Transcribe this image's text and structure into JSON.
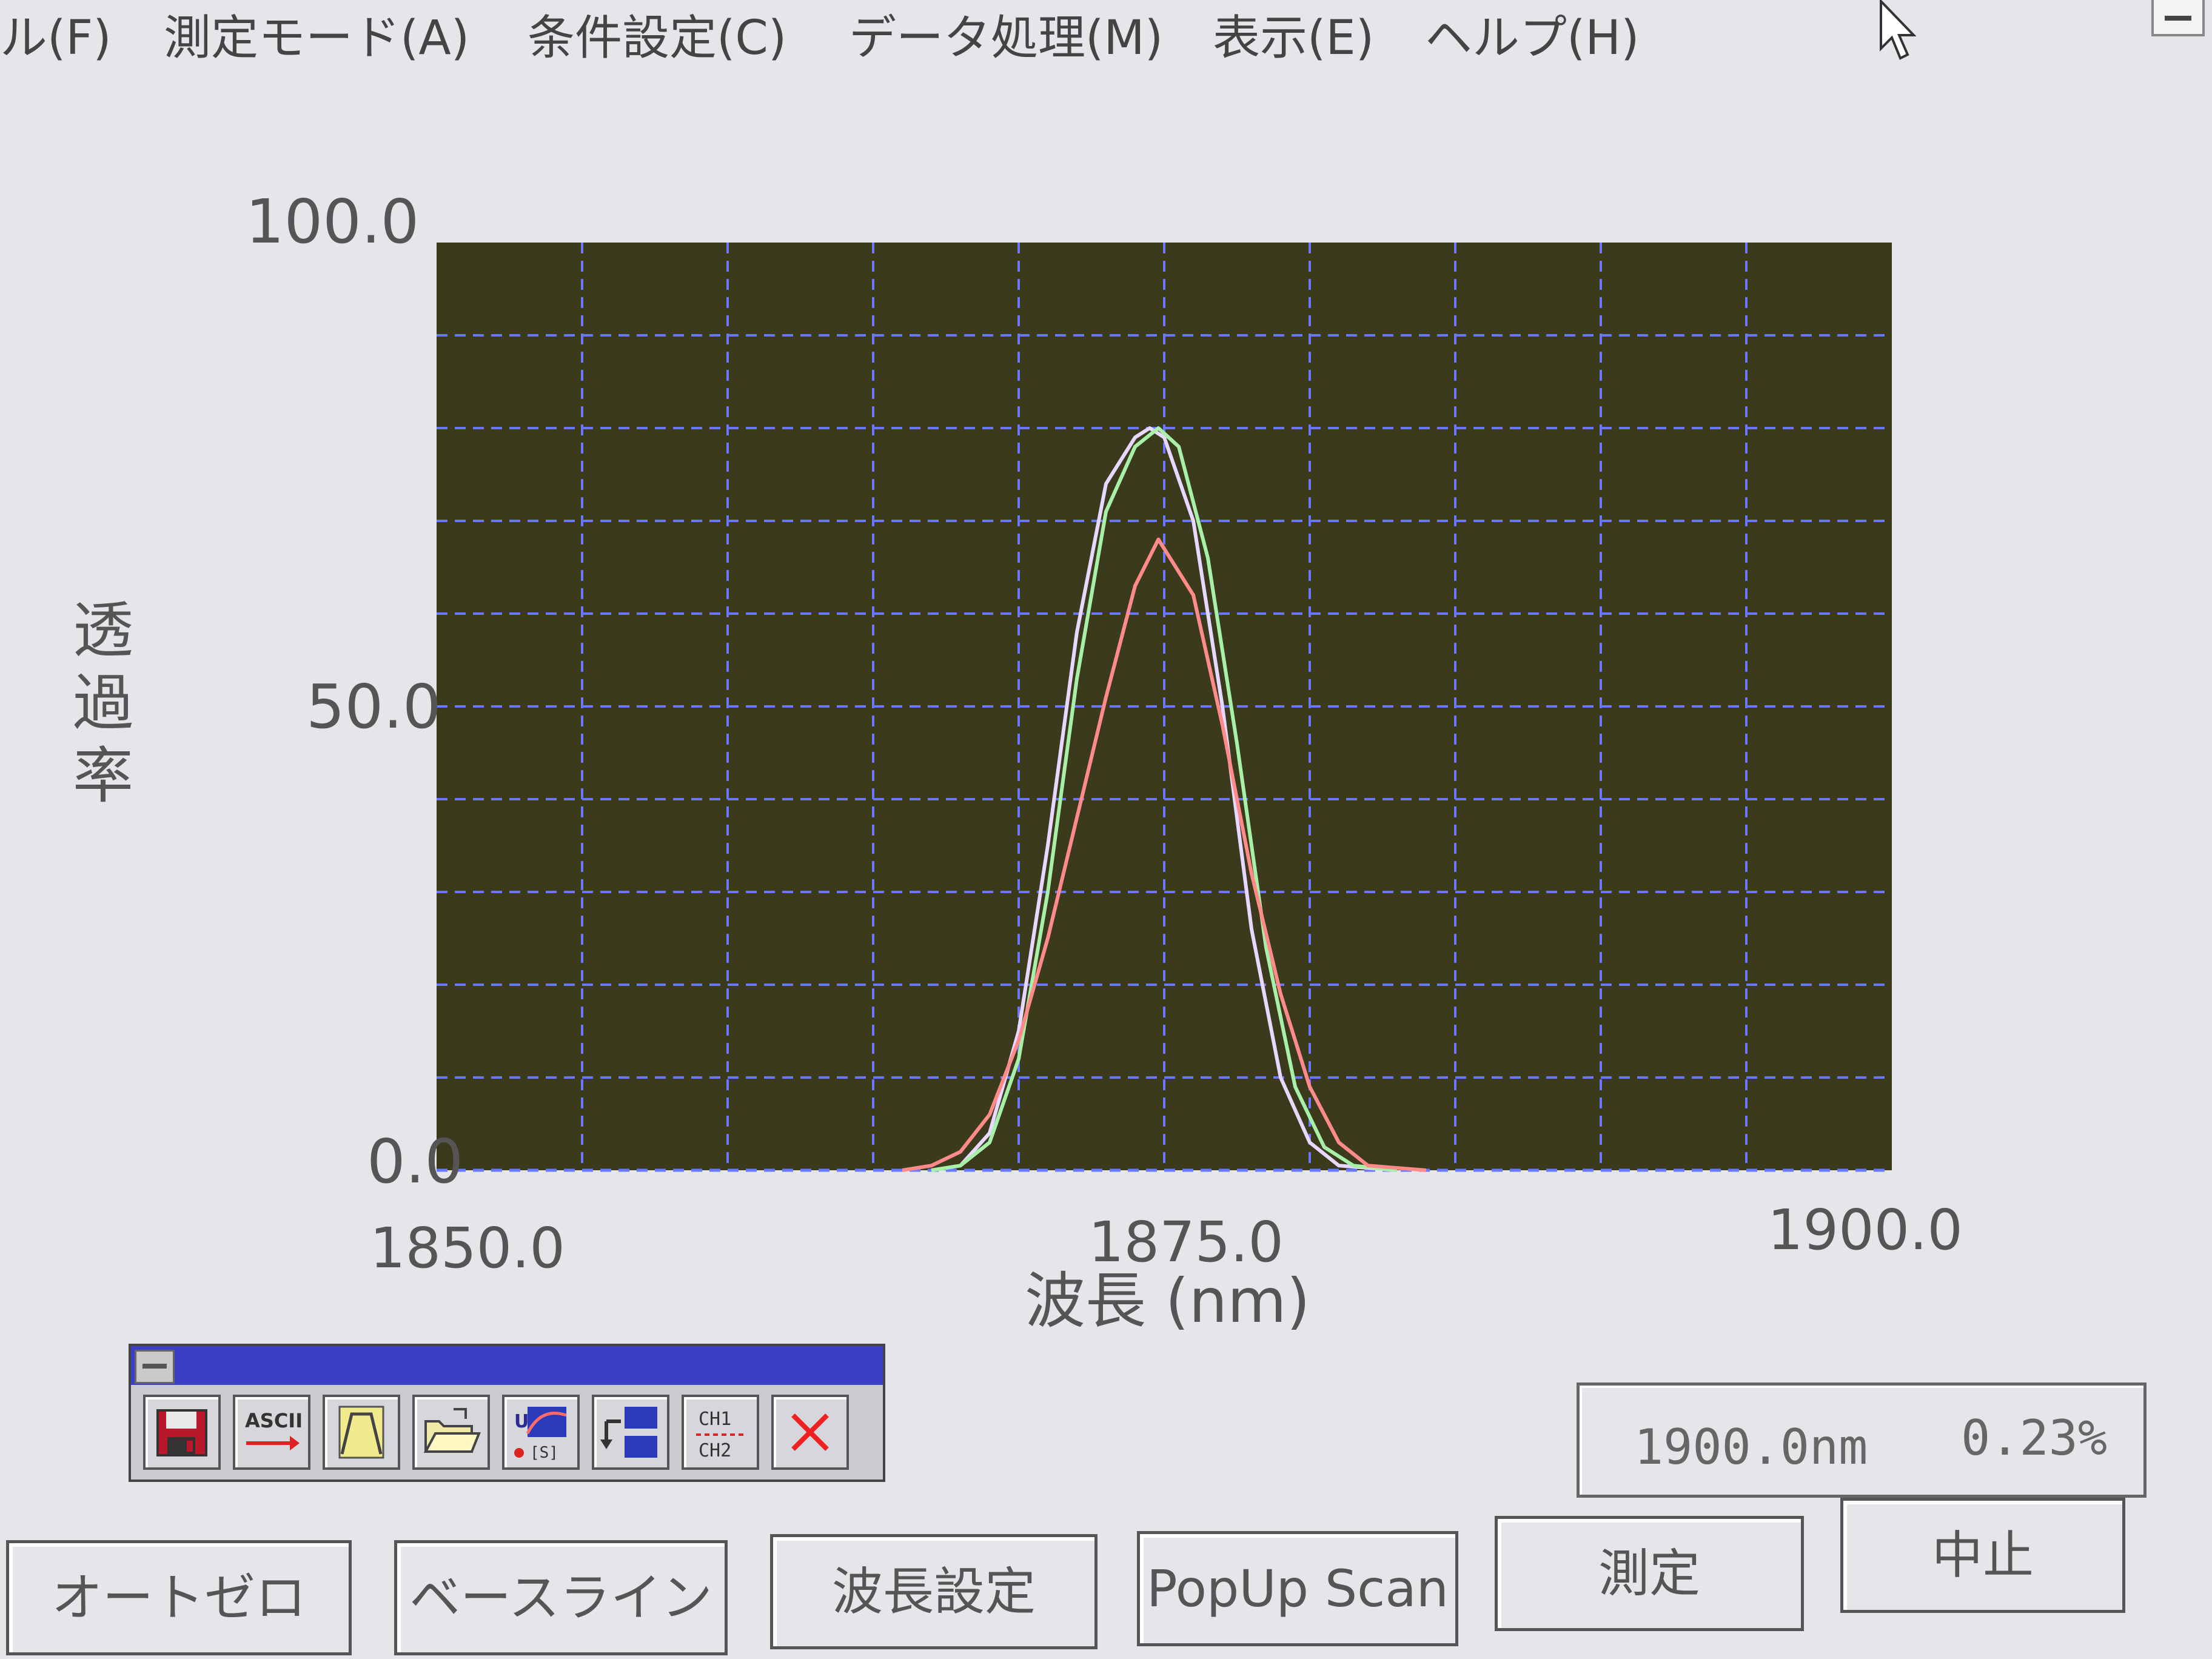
{
  "menu": {
    "items": [
      "ル(F)",
      "測定モード(A)",
      "条件設定(C)",
      "データ処理(M)",
      "表示(E)",
      "ヘルプ(H)"
    ]
  },
  "chart_data": {
    "type": "line",
    "xlabel": "波長 (nm)",
    "ylabel": "透過率",
    "xlim": [
      1850.0,
      1900.0
    ],
    "ylim": [
      0.0,
      100.0
    ],
    "x_ticks": [
      "1850.0",
      "1875.0",
      "1900.0"
    ],
    "y_ticks": [
      "100.0",
      "50.0",
      "0.0"
    ],
    "grid": true,
    "background_color": "#3b3a1c",
    "grid_color": "#6a78ff",
    "series": [
      {
        "color": "#e8d7ff",
        "x": [
          1867,
          1868,
          1869,
          1870,
          1871,
          1872,
          1873,
          1874,
          1874.5,
          1875,
          1876,
          1877,
          1878,
          1879,
          1880,
          1881,
          1883
        ],
        "y": [
          0.0,
          0.5,
          4,
          15,
          35,
          58,
          74,
          79,
          80,
          79,
          70,
          50,
          26,
          10,
          3,
          0.5,
          0.0
        ]
      },
      {
        "color": "#a8f0a8",
        "x": [
          1867,
          1868,
          1869,
          1870,
          1871,
          1872,
          1873,
          1874,
          1874.8,
          1875.5,
          1876.5,
          1877.5,
          1878.5,
          1879.5,
          1880.5,
          1881.5,
          1883
        ],
        "y": [
          0.0,
          0.5,
          3,
          12,
          30,
          53,
          71,
          78,
          80,
          78,
          66,
          46,
          24,
          9,
          2.5,
          0.5,
          0.0
        ]
      },
      {
        "color": "#ff8a8a",
        "x": [
          1866,
          1867,
          1868,
          1869,
          1870,
          1871,
          1872,
          1873,
          1874,
          1874.8,
          1876,
          1877,
          1878,
          1879,
          1880,
          1881,
          1882,
          1884
        ],
        "y": [
          0.0,
          0.5,
          2,
          6,
          14,
          25,
          38,
          51,
          63,
          68,
          62,
          48,
          32,
          19,
          9,
          3,
          0.5,
          0.0
        ]
      }
    ]
  },
  "toolbar": {
    "buttons": [
      {
        "icon": "save-icon"
      },
      {
        "icon": "ascii-export-icon",
        "label": "ASCII"
      },
      {
        "icon": "peak-icon"
      },
      {
        "icon": "open-folder-icon"
      },
      {
        "icon": "spectrum-icon",
        "label": "[S]"
      },
      {
        "icon": "channel-swap-icon"
      },
      {
        "icon": "channel-toggle-icon",
        "label_top": "CH1",
        "label_bottom": "CH2"
      },
      {
        "icon": "close-icon"
      }
    ]
  },
  "status": {
    "wavelength": "1900.0nm",
    "value": "0.23%"
  },
  "buttons": {
    "autozero": "オートゼロ",
    "baseline": "ベースライン",
    "wavelength_setting": "波長設定",
    "popup_scan": "PopUp Scan",
    "measure": "測定",
    "stop": "中止"
  }
}
